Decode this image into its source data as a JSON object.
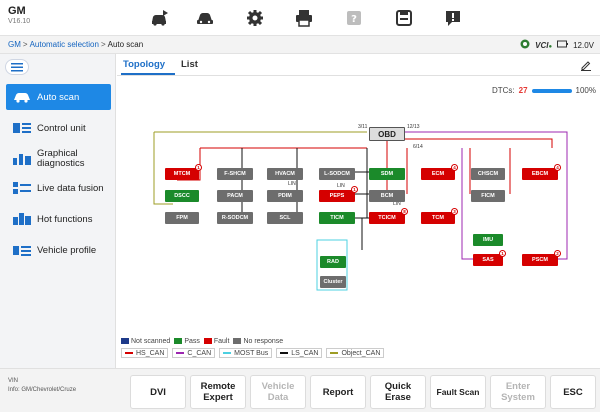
{
  "header": {
    "brand": "GM",
    "version": "V16.10",
    "icons": [
      "car-scan-icon",
      "car-icon",
      "gear-icon",
      "printer-icon",
      "help-icon",
      "save-icon",
      "feedback-icon"
    ]
  },
  "breadcrumb": {
    "items": [
      "GM",
      "Automatic selection",
      "Auto scan"
    ],
    "separator": ">"
  },
  "status": {
    "vci_label": "VCI",
    "voltage": "12.0V"
  },
  "sidebar": {
    "items": [
      {
        "label": "Auto scan",
        "icon": "car-scan-icon",
        "active": true
      },
      {
        "label": "Control unit",
        "icon": "control-unit-icon",
        "active": false
      },
      {
        "label": "Graphical diagnostics",
        "icon": "graphical-icon",
        "active": false
      },
      {
        "label": "Live data fusion",
        "icon": "live-data-icon",
        "active": false
      },
      {
        "label": "Hot functions",
        "icon": "hot-functions-icon",
        "active": false
      },
      {
        "label": "Vehicle profile",
        "icon": "vehicle-profile-icon",
        "active": false
      }
    ]
  },
  "tabs": [
    {
      "label": "Topology",
      "active": true
    },
    {
      "label": "List",
      "active": false
    }
  ],
  "dtcs": {
    "label": "DTCs:",
    "count": "27",
    "progress_label": "100%",
    "progress": 100
  },
  "topology": {
    "obd_label": "OBD",
    "bus_labels": [
      "3/11",
      "12/13",
      "6/14",
      "LIN",
      "LIN",
      "LIN"
    ],
    "nodes": [
      {
        "label": "MTCM",
        "status": "fault",
        "badge": "1"
      },
      {
        "label": "DSCC",
        "status": "pass",
        "badge": ""
      },
      {
        "label": "FPM",
        "status": "nr",
        "badge": ""
      },
      {
        "label": "F-SHCM",
        "status": "nr",
        "badge": ""
      },
      {
        "label": "PACM",
        "status": "nr",
        "badge": ""
      },
      {
        "label": "R-SODCM",
        "status": "nr",
        "badge": ""
      },
      {
        "label": "HVACM",
        "status": "nr",
        "badge": ""
      },
      {
        "label": "PDIM",
        "status": "nr",
        "badge": ""
      },
      {
        "label": "SCL",
        "status": "nr",
        "badge": ""
      },
      {
        "label": "L-SODCM",
        "status": "nr",
        "badge": ""
      },
      {
        "label": "PEPS",
        "status": "fault",
        "badge": "1"
      },
      {
        "label": "TICM",
        "status": "pass",
        "badge": ""
      },
      {
        "label": "SDM",
        "status": "pass",
        "badge": ""
      },
      {
        "label": "BCM",
        "status": "nr",
        "badge": ""
      },
      {
        "label": "TCICM",
        "status": "fault",
        "badge": "8"
      },
      {
        "label": "RAD",
        "status": "pass",
        "badge": ""
      },
      {
        "label": "Cluster",
        "status": "nr",
        "badge": ""
      },
      {
        "label": "ECM",
        "status": "fault",
        "badge": "4"
      },
      {
        "label": "TCM",
        "status": "fault",
        "badge": "3"
      },
      {
        "label": "CHSCM",
        "status": "nr",
        "badge": ""
      },
      {
        "label": "FICM",
        "status": "nr",
        "badge": ""
      },
      {
        "label": "IMU",
        "status": "pass",
        "badge": ""
      },
      {
        "label": "SAS",
        "status": "fault",
        "badge": "1"
      },
      {
        "label": "EBCM",
        "status": "fault",
        "badge": "4"
      },
      {
        "label": "PSCM",
        "status": "fault",
        "badge": "2"
      }
    ]
  },
  "legend": {
    "status": [
      {
        "label": "Not scanned",
        "color": "#1e3a8a"
      },
      {
        "label": "Pass",
        "color": "#1b8a2a"
      },
      {
        "label": "Fault",
        "color": "#d50000"
      },
      {
        "label": "No response",
        "color": "#6d6d6d"
      }
    ],
    "buses": [
      {
        "label": "HS_CAN",
        "color": "#d50000"
      },
      {
        "label": "C_CAN",
        "color": "#9c27b0"
      },
      {
        "label": "MOST Bus",
        "color": "#4dd0e1"
      },
      {
        "label": "LS_CAN",
        "color": "#111111"
      },
      {
        "label": "Object_CAN",
        "color": "#9e9d24"
      }
    ]
  },
  "footer": {
    "vin_label": "VIN",
    "info": "Info: GM/Chevrolet/Cruze",
    "buttons": [
      {
        "label": "DVI",
        "enabled": true
      },
      {
        "label": "Remote\nExpert",
        "enabled": true
      },
      {
        "label": "Vehicle\nData",
        "enabled": false
      },
      {
        "label": "Report",
        "enabled": true
      },
      {
        "label": "Quick\nErase",
        "enabled": true
      },
      {
        "label": "Fault Scan",
        "enabled": true
      },
      {
        "label": "Enter\nSystem",
        "enabled": false
      },
      {
        "label": "ESC",
        "enabled": true
      }
    ]
  }
}
